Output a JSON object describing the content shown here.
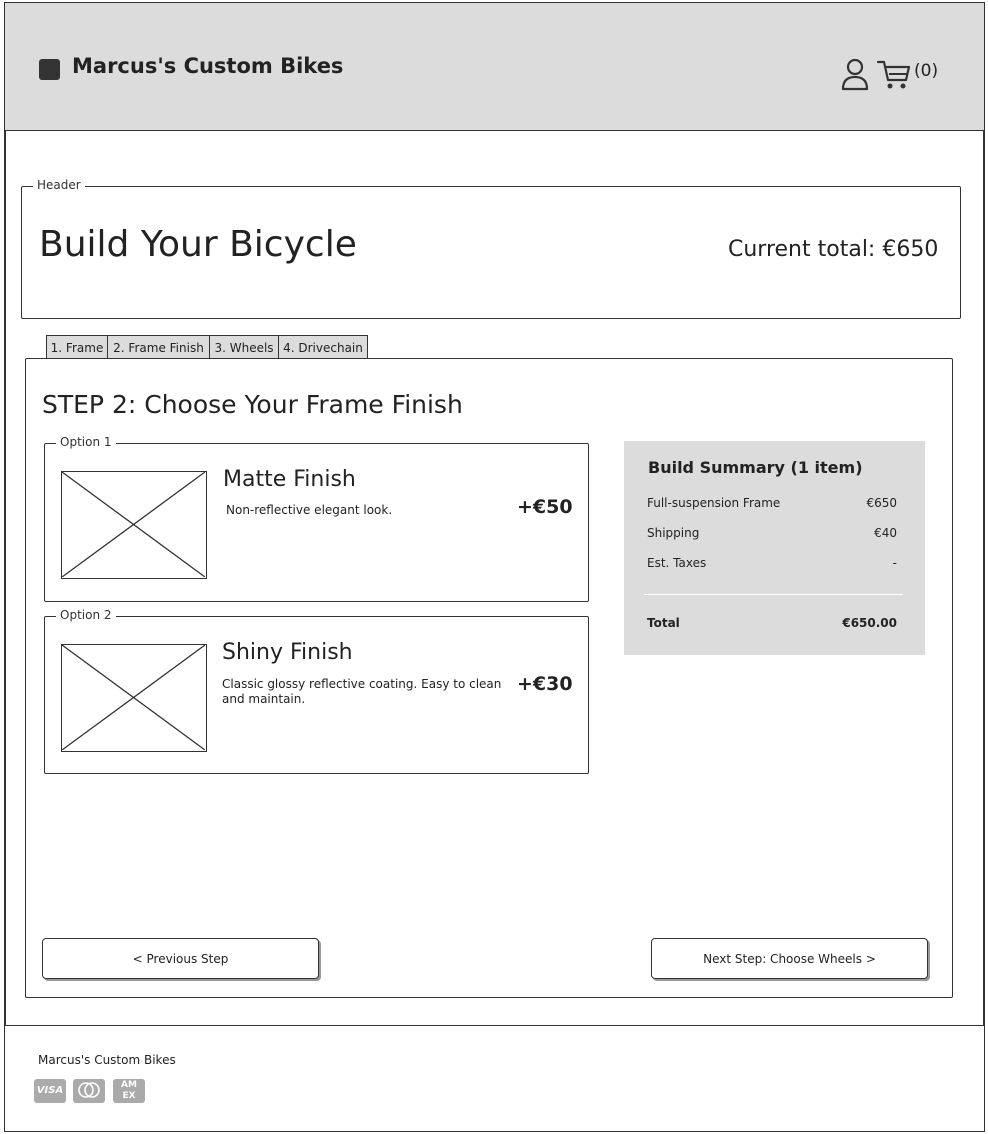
{
  "topbar": {
    "brand": "Marcus's Custom Bikes",
    "cart_count": "(0)",
    "icons": {
      "logo": "logo-square-icon",
      "user": "user-icon",
      "cart": "cart-icon"
    }
  },
  "header": {
    "legend": "Header",
    "title": "Build Your Bicycle",
    "current_total": "Current total: €650"
  },
  "tabs": [
    {
      "label": "1. Frame"
    },
    {
      "label": "2. Frame Finish"
    },
    {
      "label": "3. Wheels"
    },
    {
      "label": "4. Drivechain"
    }
  ],
  "main": {
    "step_title": "STEP 2: Choose Your Frame Finish",
    "options": [
      {
        "legend": "Option 1",
        "title": "Matte Finish",
        "description": "Non-reflective elegant look.",
        "price": "+€50"
      },
      {
        "legend": "Option 2",
        "title": "Shiny Finish",
        "description": "Classic glossy reflective coating. Easy to clean and maintain.",
        "price": "+€30"
      }
    ]
  },
  "summary": {
    "title": "Build Summary (1 item)",
    "lines": [
      {
        "label": "Full-suspension Frame",
        "value": "€650"
      },
      {
        "label": "Shipping",
        "value": "€40"
      },
      {
        "label": "Est. Taxes",
        "value": "-"
      }
    ],
    "total_label": "Total",
    "total_value": "€650.00"
  },
  "nav": {
    "prev_label": "< Previous Step",
    "next_label": "Next Step: Choose Wheels >"
  },
  "footer": {
    "brand": "Marcus's Custom Bikes",
    "payment_icons": [
      "visa-icon",
      "mastercard-icon",
      "amex-icon"
    ],
    "visa_text": "VISA",
    "amex_text": "AM EX"
  },
  "colors": {
    "panel_gray": "#dcdcdc",
    "ink": "#333333"
  }
}
